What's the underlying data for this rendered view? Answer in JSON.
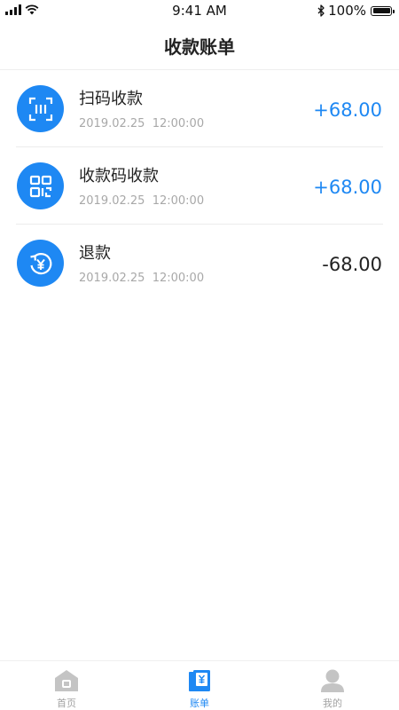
{
  "status_bar": {
    "time": "9:41 AM",
    "battery": "100%"
  },
  "header": {
    "title": "收款账单"
  },
  "transactions": [
    {
      "title": "扫码收款",
      "date": "2019.02.25",
      "time": "12:00:00",
      "amount": "+68.00",
      "icon": "scan-icon"
    },
    {
      "title": "收款码收款",
      "date": "2019.02.25",
      "time": "12:00:00",
      "amount": "+68.00",
      "icon": "qr-code-icon"
    },
    {
      "title": "退款",
      "date": "2019.02.25",
      "time": "12:00:00",
      "amount": "-68.00",
      "icon": "refund-icon"
    }
  ],
  "tab_bar": {
    "items": [
      {
        "label": "首页",
        "icon": "home-icon",
        "active": false
      },
      {
        "label": "账单",
        "icon": "bill-icon",
        "active": true
      },
      {
        "label": "我的",
        "icon": "profile-icon",
        "active": false
      }
    ]
  },
  "colors": {
    "accent": "#1e88f3",
    "inactive": "#a3a3a3"
  }
}
